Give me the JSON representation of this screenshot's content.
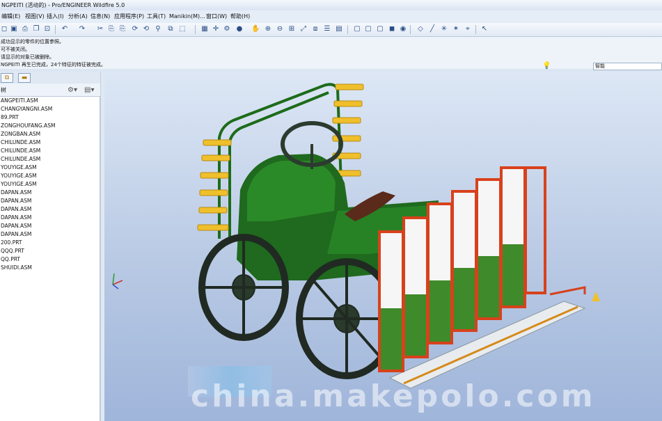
{
  "window": {
    "title": "NGPEITI (活动的) - Pro/ENGINEER Wildfire 5.0"
  },
  "menu": [
    "编辑(E)",
    "视图(V)",
    "插入(I)",
    "分析(A)",
    "信息(N)",
    "应用程序(P)",
    "工具(T)",
    "Manikin(M)...",
    "窗口(W)",
    "帮助(H)"
  ],
  "messages": [
    "成功显示的零件的位置参照。",
    "可不被关闭。",
    "请显示的对象已被删除。",
    "NGPEITI 再生已完成，24个特征的特征被完成。"
  ],
  "filter": {
    "value": "智能"
  },
  "tree": {
    "header": "树",
    "items": [
      "ANGPEITI.ASM",
      "CHANGYANGNI.ASM",
      "89.PRT",
      "ZONGHOUFANG.ASM",
      "ZONGBAN.ASM",
      "CHILUNDE.ASM",
      "CHILUNDE.ASM",
      "CHILUNDE.ASM",
      "YOUYIGE.ASM",
      "YOUYIGE.ASM",
      "YOUYIGE.ASM",
      "DAPAN.ASM",
      "DAPAN.ASM",
      "DAPAN.ASM",
      "DAPAN.ASM",
      "DAPAN.ASM",
      "DAPAN.ASM",
      "200.PRT",
      "QQQ.PRT",
      "QQ.PRT",
      "SHUIDI.ASM"
    ]
  },
  "watermark": "china.makepolo.com",
  "colors": {
    "accent": "#2a4f86",
    "body_green": "#1f6a1e",
    "frame_red": "#d8411c",
    "clip_yellow": "#f0c02c"
  }
}
